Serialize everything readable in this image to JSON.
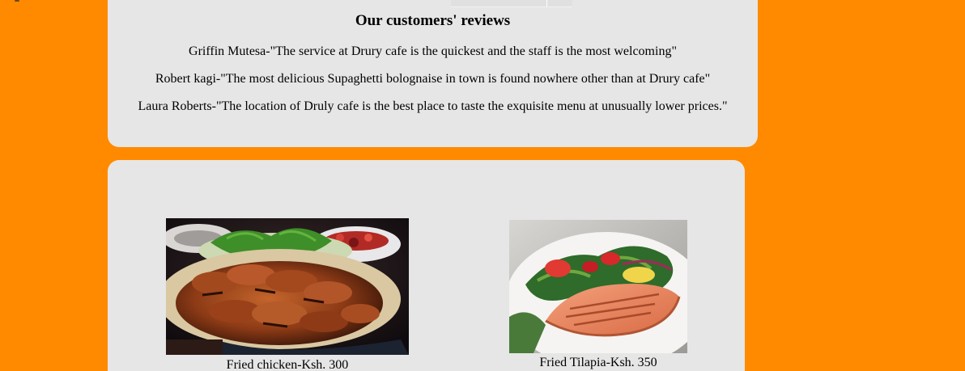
{
  "reviews": {
    "title": "Our customers' reviews",
    "items": [
      {
        "text": "Griffin Mutesa-\"The service at Drury cafe is the quickest and the staff is the most welcoming\""
      },
      {
        "text": "Robert kagi-\"The most delicious Supaghetti bolognaise in town is found nowhere other than at Drury cafe\""
      },
      {
        "text": "Laura Roberts-\"The location of Druly cafe is the best place to taste the exquisite menu at unusually lower prices.\""
      }
    ]
  },
  "menu": {
    "items": [
      {
        "caption": "Fried chicken-Ksh. 300",
        "image": "fried-chicken-photo"
      },
      {
        "caption": "Fried Tilapia-Ksh. 350",
        "image": "fried-tilapia-photo"
      }
    ]
  },
  "colors": {
    "page_background": "#ff8a00",
    "card_background": "#e6e6e6"
  }
}
